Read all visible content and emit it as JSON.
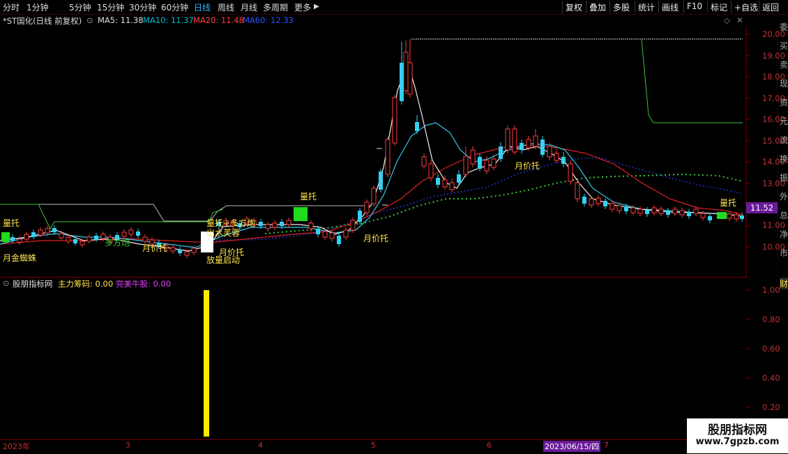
{
  "toolbar": {
    "tabs": [
      "分时",
      "1分钟",
      "5分钟",
      "15分钟",
      "30分钟",
      "60分钟",
      "日线",
      "周线",
      "月线",
      "多周期",
      "更多"
    ],
    "active_tab": "日线",
    "right_buttons": [
      "复权",
      "叠加",
      "多股",
      "统计",
      "画线",
      "F10",
      "标记",
      "+自选",
      "返回"
    ]
  },
  "infobar": {
    "title": "*ST国化(日线 前复权)",
    "ma5": "MA5: 11.38",
    "ma10": "MA10: 11.37",
    "ma20": "MA20: 11.48",
    "ma60": "MA60: 12.33",
    "colors": {
      "ma5": "#e0e0e0",
      "ma10": "#00bcd4",
      "ma20": "#ff4040",
      "ma60": "#3050ff"
    }
  },
  "price_axis": {
    "labels": [
      "20.00",
      "19.00",
      "18.00",
      "17.00",
      "16.00",
      "15.00",
      "14.00",
      "13.00",
      "12.00",
      "11.00",
      "10.00"
    ],
    "current": "11.52"
  },
  "annotations": {
    "left_liangtuo": "量托",
    "yue_jin_zhizhu": "月金蜘蛛",
    "duofang_text": "多方炮",
    "yue_jiatuo_1": "月价托",
    "liangtuo_2": "量托",
    "duofangpao": "量托+多方炮",
    "chushui": "出水芙蓉",
    "yue_jiatuo_2": "月价托",
    "fangliang": "放量启动",
    "liangtuo_3": "量托",
    "yue_jiatuo_3": "月价托",
    "yue_jiatuo_4": "月价托",
    "liangtuo_right": "量托"
  },
  "sub_chart": {
    "title": "股朋指标网",
    "zhuli": "主力筹码: 0.00",
    "wanmei": "完美牛股: 0.00",
    "axis_labels": [
      "1.00",
      "0.80",
      "0.60",
      "0.40",
      "0.20"
    ]
  },
  "time_axis": {
    "labels": [
      "2023年",
      "3",
      "4",
      "5",
      "6",
      "7"
    ],
    "cursor_date": "2023/06/15/四"
  },
  "side_chars": [
    "委",
    "买",
    "卖",
    "现",
    "资",
    "元",
    "流",
    "换",
    "振",
    "外",
    "总",
    "净",
    "市"
  ],
  "sub_side_char": "财",
  "watermark": {
    "title": "股朋指标网",
    "url": "www.7gpzb.com"
  }
}
